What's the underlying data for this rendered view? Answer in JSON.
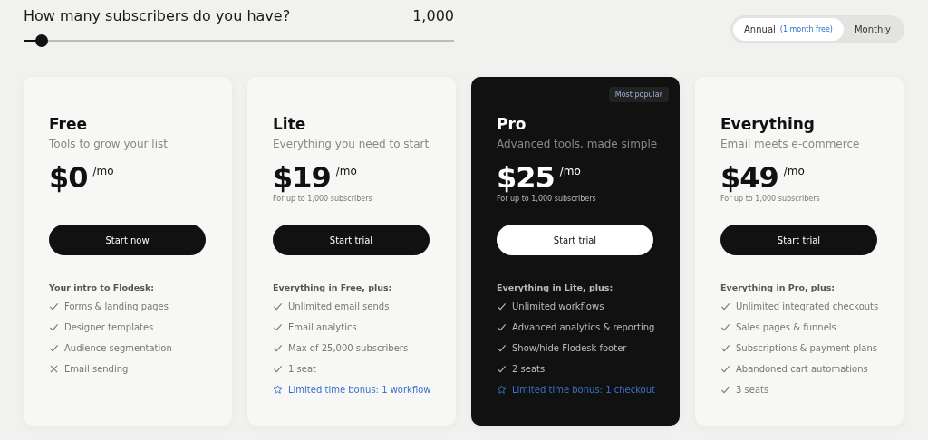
{
  "subscribers": {
    "question": "How many subscribers do you have?",
    "value": "1,000",
    "level": 0.03
  },
  "billing": [
    {
      "label": "Annual",
      "note": "(1 month free)",
      "selected": true
    },
    {
      "label": "Monthly",
      "selected": false
    }
  ],
  "plans": [
    {
      "name": "Free",
      "tagline": "Tools to grow your list",
      "price": "$0",
      "period": "/mo",
      "button": "Start now",
      "featured": false,
      "features_heading": "Your intro to Flodesk:",
      "features": [
        {
          "kind": "check",
          "text": "Forms & landing pages"
        },
        {
          "kind": "check",
          "text": "Designer templates"
        },
        {
          "kind": "check",
          "text": "Audience segmentation"
        },
        {
          "kind": "cross",
          "text": "Email sending"
        }
      ]
    },
    {
      "name": "Lite",
      "tagline": "Everything you need to start",
      "price": "$19",
      "period": "/mo",
      "note": "For up to 1,000 subscribers",
      "button": "Start trial",
      "featured": false,
      "features_heading": "Everything in Free, plus:",
      "features": [
        {
          "kind": "check",
          "text": "Unlimited email sends"
        },
        {
          "kind": "check",
          "text": "Email analytics"
        },
        {
          "kind": "check",
          "text": "Max of 25,000 subscribers"
        },
        {
          "kind": "check",
          "text": "1 seat"
        },
        {
          "kind": "bonus",
          "text": "Limited time bonus: 1 workflow"
        }
      ]
    },
    {
      "name": "Pro",
      "badge": "Most popular",
      "tagline": "Advanced tools, made simple",
      "price": "$25",
      "period": "/mo",
      "note": "For up to 1,000 subscribers",
      "button": "Start trial",
      "featured": true,
      "features_heading": "Everything in Lite, plus:",
      "features": [
        {
          "kind": "check",
          "text": "Unlimited workflows"
        },
        {
          "kind": "check",
          "text": "Advanced analytics & reporting"
        },
        {
          "kind": "check",
          "text": "Show/hide Flodesk footer"
        },
        {
          "kind": "check",
          "text": "2 seats"
        },
        {
          "kind": "bonus",
          "text": "Limited time bonus: 1 checkout"
        }
      ]
    },
    {
      "name": "Everything",
      "tagline": "Email meets e-commerce",
      "price": "$49",
      "period": "/mo",
      "note": "For up to 1,000 subscribers",
      "button": "Start trial",
      "featured": false,
      "features_heading": "Everything in Pro, plus:",
      "features": [
        {
          "kind": "check",
          "text": "Unlimited integrated checkouts"
        },
        {
          "kind": "check",
          "text": "Sales pages & funnels"
        },
        {
          "kind": "check",
          "text": "Subscriptions & payment plans"
        },
        {
          "kind": "check",
          "text": "Abandoned cart automations"
        },
        {
          "kind": "check",
          "text": "3 seats"
        }
      ]
    }
  ]
}
